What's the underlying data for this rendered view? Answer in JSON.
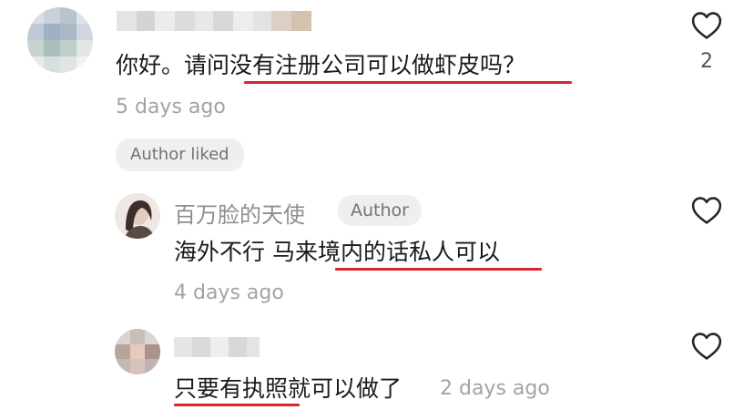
{
  "comments": [
    {
      "text": "你好。请问没有注册公司可以做虾皮吗？",
      "time": "5 days ago",
      "badge": "Author liked",
      "likes": "2",
      "heart_icon": "heart-outline-icon"
    },
    {
      "author": "百万脸的天使",
      "author_badge": "Author",
      "text": "海外不行 马来境内的话私人可以",
      "time": "4 days ago",
      "heart_icon": "heart-outline-icon"
    },
    {
      "text": "只要有执照就可以做了",
      "time": "2 days ago",
      "heart_icon": "heart-outline-icon"
    }
  ],
  "colors": {
    "underline": "#d9262e",
    "muted": "#a3a3a3",
    "chip_bg": "#efefef"
  }
}
